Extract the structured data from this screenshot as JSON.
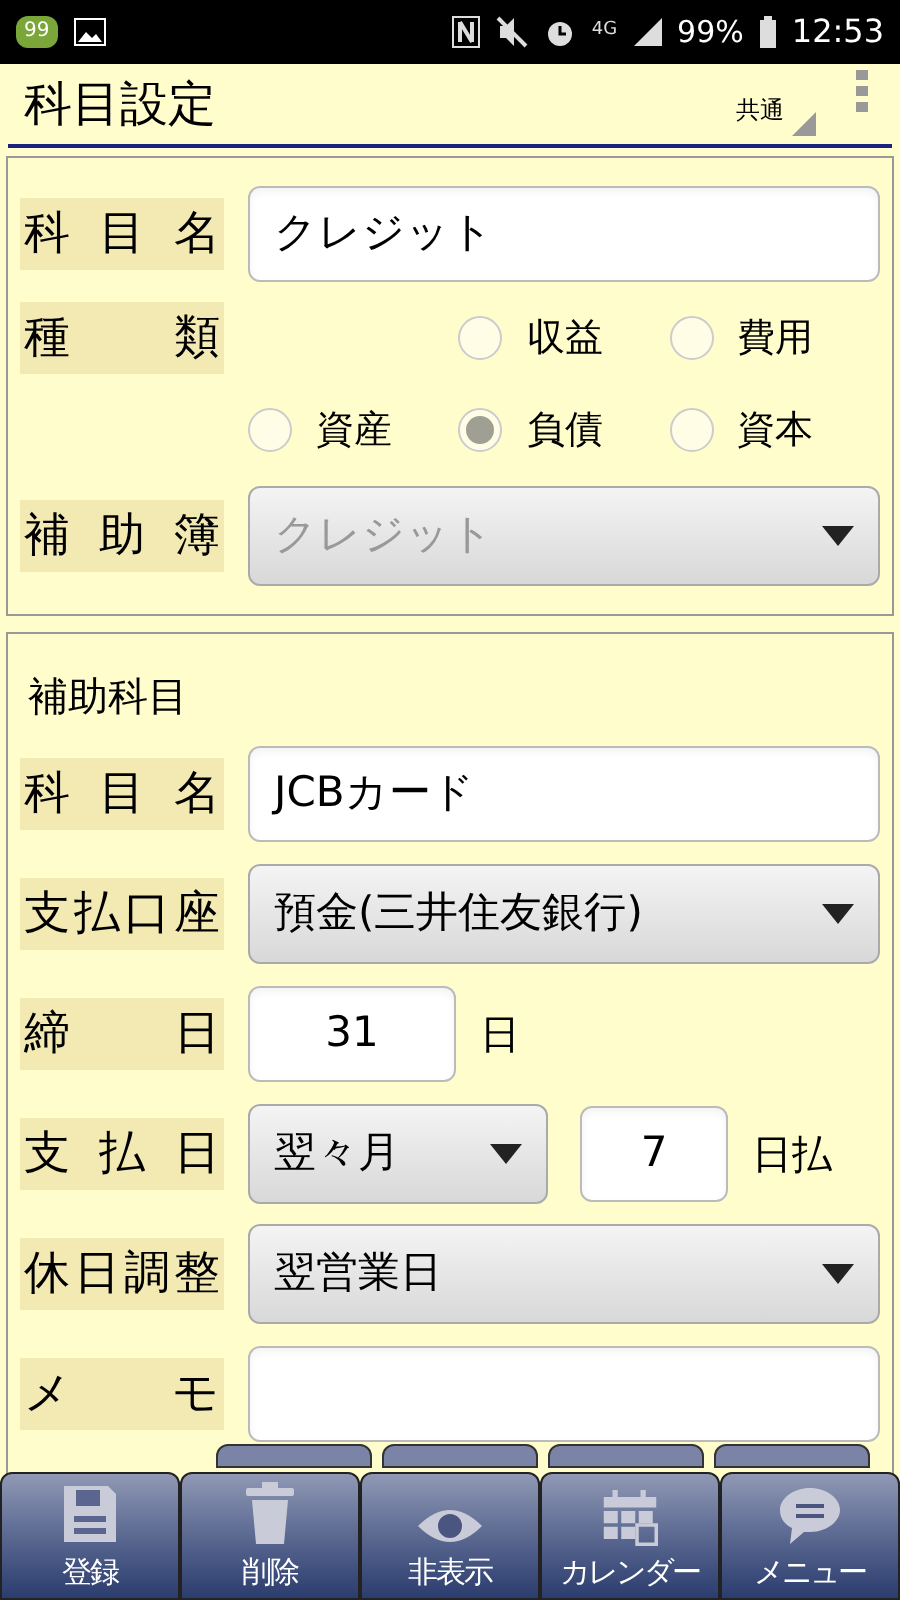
{
  "status_bar": {
    "app_badge": "99",
    "network": "4G",
    "battery": "99%",
    "time": "12:53"
  },
  "header": {
    "title": "科目設定",
    "scope": "共通"
  },
  "account": {
    "name_label": "科目名",
    "name_value": "クレジット",
    "type_label": "種類",
    "types": [
      {
        "label": "収益",
        "selected": false
      },
      {
        "label": "費用",
        "selected": false
      },
      {
        "label": "資産",
        "selected": false
      },
      {
        "label": "負債",
        "selected": true
      },
      {
        "label": "資本",
        "selected": false
      }
    ],
    "subledger_label": "補助簿",
    "subledger_value": "クレジット",
    "subledger_disabled": true
  },
  "sub_account": {
    "heading": "補助科目",
    "rows": [
      {
        "kind": "input",
        "label": "科目名",
        "value": "JCBカード"
      },
      {
        "kind": "select",
        "label": "支払口座",
        "value": "預金(三井住友銀行)"
      },
      {
        "kind": "day",
        "label": "締日",
        "value": "31",
        "suffix": "日"
      },
      {
        "kind": "payday",
        "label": "支払日",
        "value": "翌々月",
        "day": "7",
        "suffix": "日払"
      },
      {
        "kind": "select",
        "label": "休日調整",
        "value": "翌営業日"
      },
      {
        "kind": "input",
        "label": "メモ",
        "value": ""
      }
    ]
  },
  "toolbar": [
    {
      "label": "登録",
      "kind": "save"
    },
    {
      "label": "削除",
      "kind": "trash"
    },
    {
      "label": "非表示",
      "kind": "eye"
    },
    {
      "label": "カレンダー",
      "kind": "calendar"
    },
    {
      "label": "メニュー",
      "kind": "chat"
    }
  ]
}
